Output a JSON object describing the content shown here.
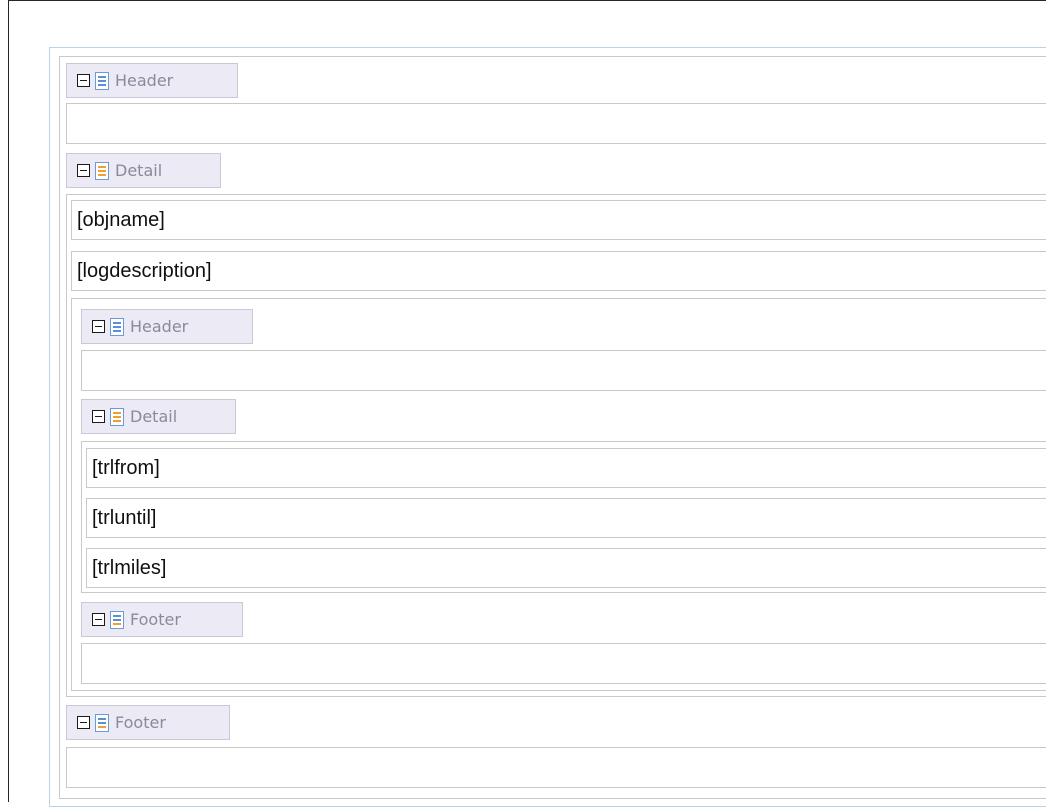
{
  "bands": {
    "header": "Header",
    "detail": "Detail",
    "footer": "Footer"
  },
  "nested": {
    "header": "Header",
    "detail": "Detail",
    "footer": "Footer"
  },
  "fields": {
    "objname": "[objname]",
    "logdescription": "[logdescription]",
    "trlfrom": "[trlfrom]",
    "trluntil": "[trluntil]",
    "trlmiles": "[trlmiles]"
  },
  "colors": {
    "band_tab": "#ebeaf5",
    "icon_header_lines": "#5b8fd6",
    "icon_detail_lines": "#f0a030",
    "icon_footer_lines": "#f0a030",
    "outer_border": "#bcd3e6"
  },
  "icons": {
    "toggle": "collapse-minus-icon",
    "band": "band-section-icon"
  }
}
